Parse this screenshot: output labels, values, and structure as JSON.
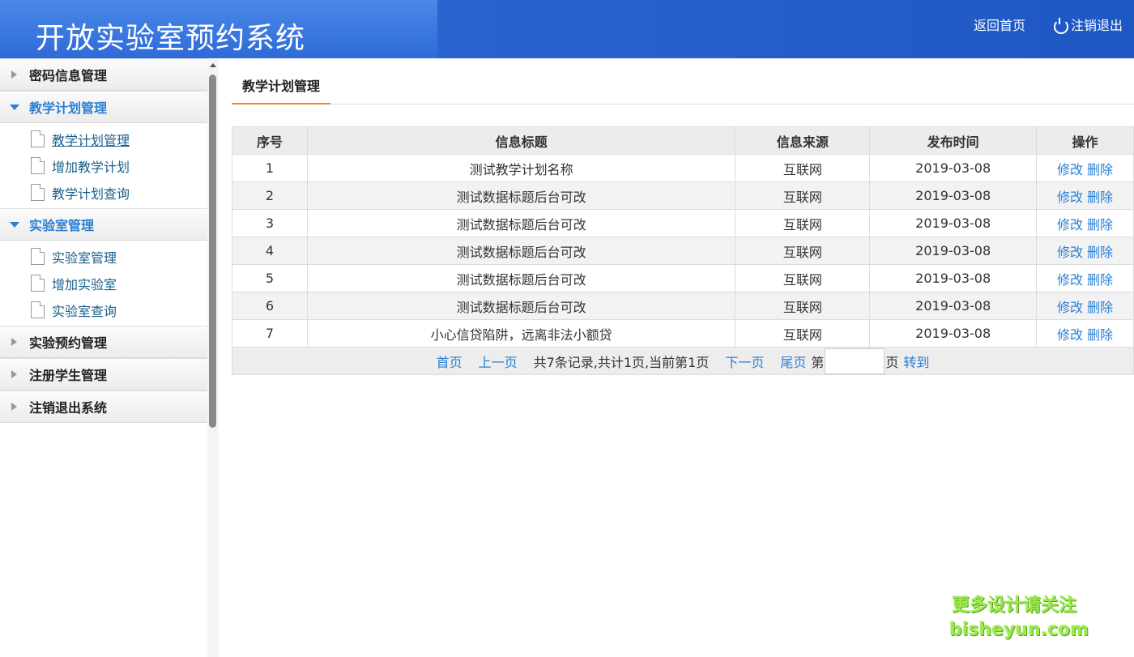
{
  "header": {
    "title": "开放实验室预约系统",
    "home_link": "返回首页",
    "logout_link": "注销退出"
  },
  "sidebar": {
    "groups": [
      {
        "label": "密码信息管理",
        "open": false
      },
      {
        "label": "教学计划管理",
        "open": true,
        "items": [
          "教学计划管理",
          "增加教学计划",
          "教学计划查询"
        ]
      },
      {
        "label": "实验室管理",
        "open": true,
        "items": [
          "实验室管理",
          "增加实验室",
          "实验室查询"
        ]
      },
      {
        "label": "实验预约管理",
        "open": false
      },
      {
        "label": "注册学生管理",
        "open": false
      },
      {
        "label": "注销退出系统",
        "open": false
      }
    ],
    "active_item": "教学计划管理"
  },
  "main": {
    "tab_label": "教学计划管理",
    "table": {
      "columns": [
        "序号",
        "信息标题",
        "信息来源",
        "发布时间",
        "操作"
      ],
      "rows": [
        {
          "no": "1",
          "title": "测试教学计划名称",
          "source": "互联网",
          "date": "2019-03-08"
        },
        {
          "no": "2",
          "title": "测试数据标题后台可改",
          "source": "互联网",
          "date": "2019-03-08"
        },
        {
          "no": "3",
          "title": "测试数据标题后台可改",
          "source": "互联网",
          "date": "2019-03-08"
        },
        {
          "no": "4",
          "title": "测试数据标题后台可改",
          "source": "互联网",
          "date": "2019-03-08"
        },
        {
          "no": "5",
          "title": "测试数据标题后台可改",
          "source": "互联网",
          "date": "2019-03-08"
        },
        {
          "no": "6",
          "title": "测试数据标题后台可改",
          "source": "互联网",
          "date": "2019-03-08"
        },
        {
          "no": "7",
          "title": "小心信贷陷阱，远离非法小额贷",
          "source": "互联网",
          "date": "2019-03-08"
        }
      ],
      "edit_label": "修改",
      "delete_label": "删除"
    },
    "pager": {
      "first": "首页",
      "prev": "上一页",
      "summary": "共7条记录,共计1页,当前第1页",
      "next": "下一页",
      "last": "尾页",
      "page_prefix": "第",
      "page_input_value": "",
      "page_suffix": "页",
      "go": "转到"
    }
  },
  "watermark": {
    "line1": "更多设计请关注",
    "line2": "bisheyun.com"
  }
}
